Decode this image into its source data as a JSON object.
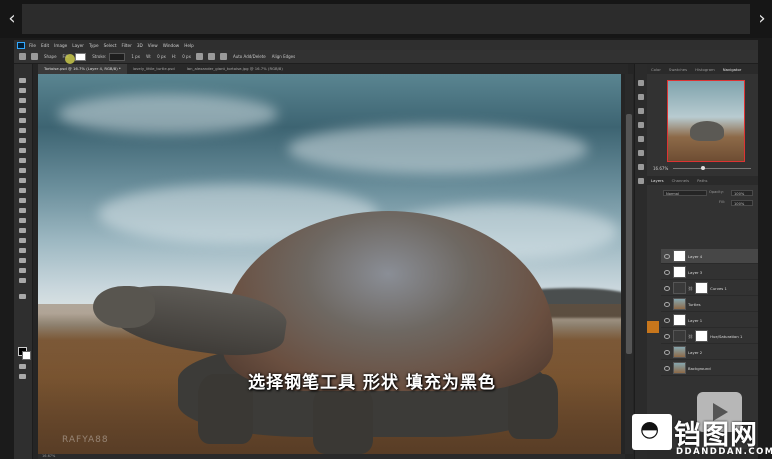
{
  "player": {
    "prev_arrow": "‹",
    "next_arrow": "›"
  },
  "menu": {
    "items": [
      "File",
      "Edit",
      "Image",
      "Layer",
      "Type",
      "Select",
      "Filter",
      "3D",
      "View",
      "Window",
      "Help"
    ]
  },
  "options_bar": {
    "shape_mode": "Shape",
    "fill_label": "Fill:",
    "stroke_label": "Stroke:",
    "stroke_size": "1 px",
    "w_label": "W:",
    "w_value": "0 px",
    "h_label": "H:",
    "h_value": "0 px",
    "auto_add_delete": "Auto Add/Delete",
    "align_edges": "Align Edges"
  },
  "document_tabs": [
    {
      "label": "Tortoise.psd @ 16.7% (Layer 4, RGB/8) *",
      "active": true
    },
    {
      "label": "lovely_little_turtle.psd",
      "active": false
    },
    {
      "label": "Ian_alexander_giant_tortoise.jpg @ 16.7% (RGB/8)",
      "active": false
    }
  ],
  "right_panel": {
    "tabs": [
      "Color",
      "Swatches",
      "Histogram",
      "Navigator"
    ],
    "active_tab": "Navigator",
    "zoom": "16.67%",
    "layer_tabs": [
      "Layers",
      "Channels",
      "Paths"
    ],
    "blend_mode": "Normal",
    "opacity_label": "Opacity:",
    "opacity_value": "100%",
    "fill_label": "Fill:",
    "fill_value": "100%",
    "layers": [
      {
        "name": "Layer 4",
        "kind": "white",
        "selected": true
      },
      {
        "name": "Layer 3",
        "kind": "white",
        "selected": false
      },
      {
        "name": "Curves 1",
        "kind": "adjust",
        "selected": false
      },
      {
        "name": "Turtles",
        "kind": "photo",
        "selected": false
      },
      {
        "name": "Layer 1",
        "kind": "white",
        "selected": false
      },
      {
        "name": "Hue/Saturation 1",
        "kind": "adjust",
        "selected": false
      },
      {
        "name": "Layer 2",
        "kind": "photo",
        "selected": false
      },
      {
        "name": "Background",
        "kind": "photo",
        "selected": false
      }
    ]
  },
  "canvas": {
    "watermark": "RAFYA88",
    "status": "16.67%"
  },
  "subtitle": "选择钢笔工具 形状 填充为黑色",
  "site_logo": {
    "glyph": "◓",
    "name_cn": "铛图网",
    "name_en": "DDANDDAN.COM"
  },
  "colors": {
    "accent_orange": "#c7761c",
    "selection_red": "#dd3333"
  }
}
